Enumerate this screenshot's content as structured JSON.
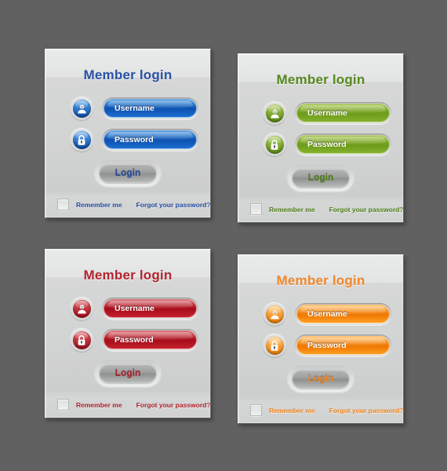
{
  "page": {
    "background_color": "#616161"
  },
  "common": {
    "title": "Member login",
    "username_label": "Username",
    "password_label": "Password",
    "login_label": "Login",
    "remember_label": "Remember me",
    "forgot_label": "Forgot your password?",
    "user_icon": "user-icon",
    "lock_icon": "lock-icon",
    "checkbox_checked": false
  },
  "panels": [
    {
      "variant": "blue",
      "title": "Member login",
      "username_label": "Username",
      "password_label": "Password",
      "login_label": "Login",
      "remember_label": "Remember me",
      "forgot_label": "Forgot your password?",
      "accent": "#1f4fa8",
      "title_color": "#2a52a6",
      "text_color": "#23499c",
      "field_top": "#4b9ce4",
      "field_mid": "#0f55b5",
      "field_bottom": "#1d6fd0",
      "icon_top": "#5ba6ea",
      "icon_bottom": "#0b4ba8"
    },
    {
      "variant": "green",
      "title": "Member login",
      "username_label": "Username",
      "password_label": "Password",
      "login_label": "Login",
      "remember_label": "Remember me",
      "forgot_label": "Forgot your password?",
      "accent": "#5d8f1f",
      "title_color": "#56891c",
      "text_color": "#4d7d18",
      "field_top": "#a2c44a",
      "field_mid": "#6f9e1c",
      "field_bottom": "#86b22e",
      "icon_top": "#aacb56",
      "icon_bottom": "#5c8a15"
    },
    {
      "variant": "red",
      "title": "Member login",
      "username_label": "Username",
      "password_label": "Password",
      "login_label": "Login",
      "remember_label": "Remember me",
      "forgot_label": "Forgot your password?",
      "accent": "#b4212c",
      "title_color": "#b32630",
      "text_color": "#ab1f29",
      "field_top": "#d9656d",
      "field_mid": "#ab0f1c",
      "field_bottom": "#c6212e",
      "icon_top": "#da5a62",
      "icon_bottom": "#a30d19"
    },
    {
      "variant": "orange",
      "title": "Member login",
      "username_label": "Username",
      "password_label": "Password",
      "login_label": "Login",
      "remember_label": "Remember me",
      "forgot_label": "Forgot your password?",
      "accent": "#f08a1e",
      "title_color": "#f2872a",
      "text_color": "#ef851f",
      "field_top": "#ffc06a",
      "field_mid": "#f07c07",
      "field_bottom": "#ff9d20",
      "icon_top": "#ffc46f",
      "icon_bottom": "#ef7d06"
    }
  ]
}
